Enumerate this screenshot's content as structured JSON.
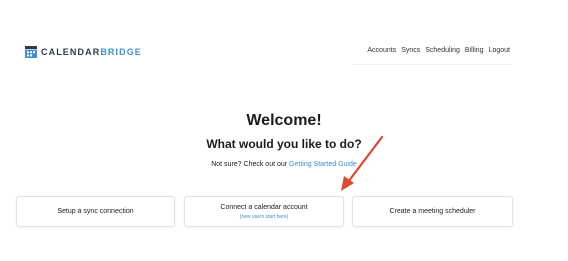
{
  "brand": {
    "name_part1": "CALENDAR",
    "name_part2": "BRIDGE",
    "color_dark": "#2f3b47",
    "color_accent": "#3d8fd6",
    "logo_icon": "calendar-logo-icon"
  },
  "nav": {
    "items": [
      {
        "label": "Accounts"
      },
      {
        "label": "Syncs"
      },
      {
        "label": "Scheduling"
      },
      {
        "label": "Billing"
      },
      {
        "label": "Logout"
      }
    ]
  },
  "main": {
    "heading": "Welcome!",
    "subheading": "What would you like to do?",
    "help_prefix": "Not sure? Check out our ",
    "help_link": "Getting Started Guide"
  },
  "options": [
    {
      "title": "Setup a sync connection"
    },
    {
      "title": "Connect a calendar account",
      "subtitle": "(new users start here)"
    },
    {
      "title": "Create a meeting scheduler"
    }
  ],
  "annotation": {
    "arrow_color": "#e0482f",
    "arrow_icon": "red-pointer-arrow"
  }
}
